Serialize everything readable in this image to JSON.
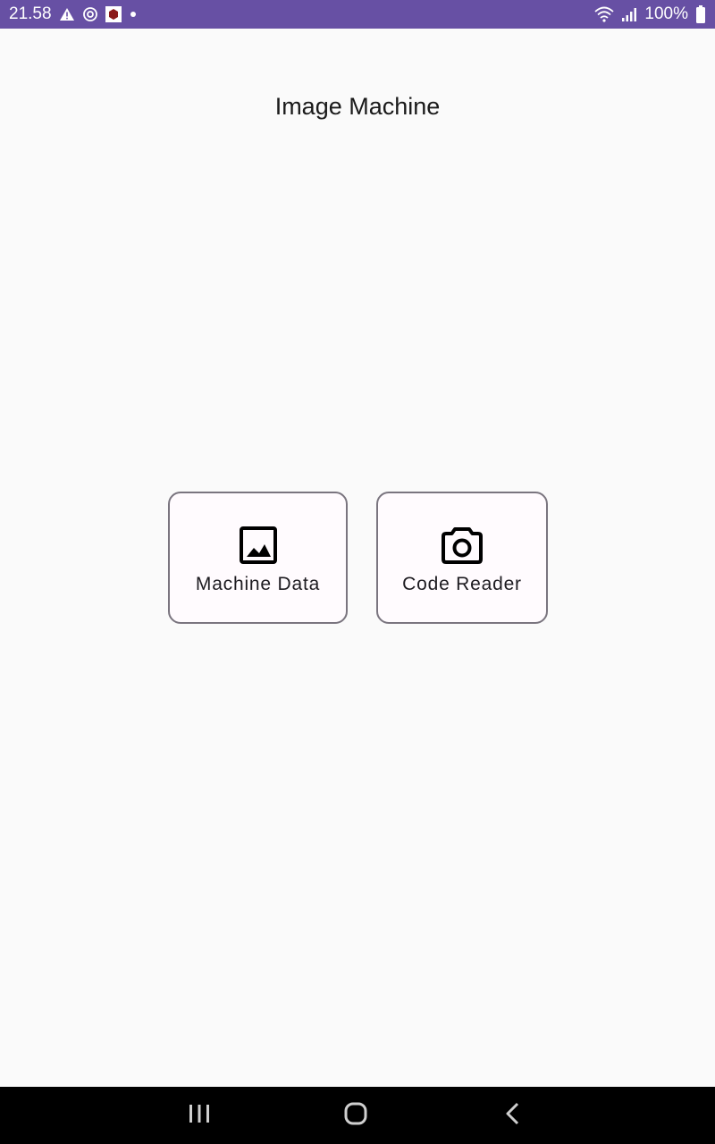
{
  "status_bar": {
    "time": "21.58",
    "battery_percent": "100%",
    "icons_left": [
      "warning-icon",
      "sync-icon",
      "app-notification-icon",
      "dot-icon"
    ],
    "icons_right": [
      "wifi-icon",
      "signal-icon",
      "battery-icon"
    ],
    "background_color": "#6750a4"
  },
  "app": {
    "title": "Image Machine"
  },
  "buttons": [
    {
      "label": "Machine Data",
      "icon": "image-icon"
    },
    {
      "label": "Code Reader",
      "icon": "camera-icon"
    }
  ],
  "nav_bar": {
    "items": [
      "recents-icon",
      "home-icon",
      "back-icon"
    ]
  }
}
